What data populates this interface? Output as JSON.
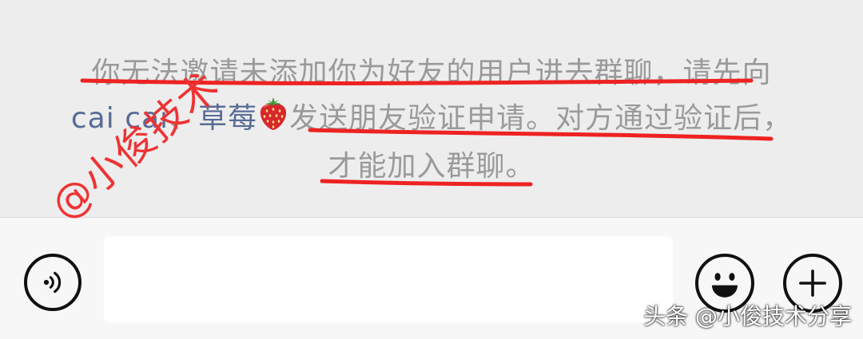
{
  "colors": {
    "chat_background": "#ededed",
    "input_bar_background": "#f7f7f7",
    "notice_text": "#9a9a9a",
    "mention_link": "#576b95",
    "annotation_red": "#ee2222"
  },
  "system_notice": {
    "line1": "你无法邀请未添加你为好友的用户进去群聊，请先向",
    "mention1": "cai cai",
    "separator": "、",
    "mention2": "草莓",
    "emoji_icon": "strawberry-icon",
    "line2_rest": "发送朋友验证申请。对方通过验证后，",
    "line3": "才能加入群聊。"
  },
  "input_bar": {
    "voice_icon": "voice-icon",
    "input_value": "",
    "emoji_icon": "smiley-icon",
    "plus_icon": "plus-icon"
  },
  "watermark": {
    "handwritten": "@小俊技术",
    "credit": "头条 @小俊技术分享"
  }
}
